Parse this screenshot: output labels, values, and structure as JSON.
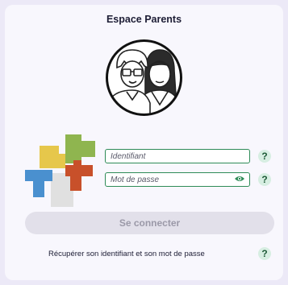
{
  "page": {
    "title": "Espace Parents"
  },
  "form": {
    "username_placeholder": "Identifiant",
    "password_placeholder": "Mot de passe",
    "submit_label": "Se connecter",
    "recover_label": "Récupérer son identifiant et son mot de passe"
  },
  "help": {
    "symbol": "?"
  },
  "icons": {
    "avatar": "parents-avatar-icon",
    "logo": "school-logo-icon",
    "eye": "eye-icon",
    "help": "help-icon"
  },
  "colors": {
    "accent": "#2e8b57",
    "button_bg": "#e2e0ea",
    "button_text": "#9b99a8",
    "help_bg": "#d7eee2"
  }
}
